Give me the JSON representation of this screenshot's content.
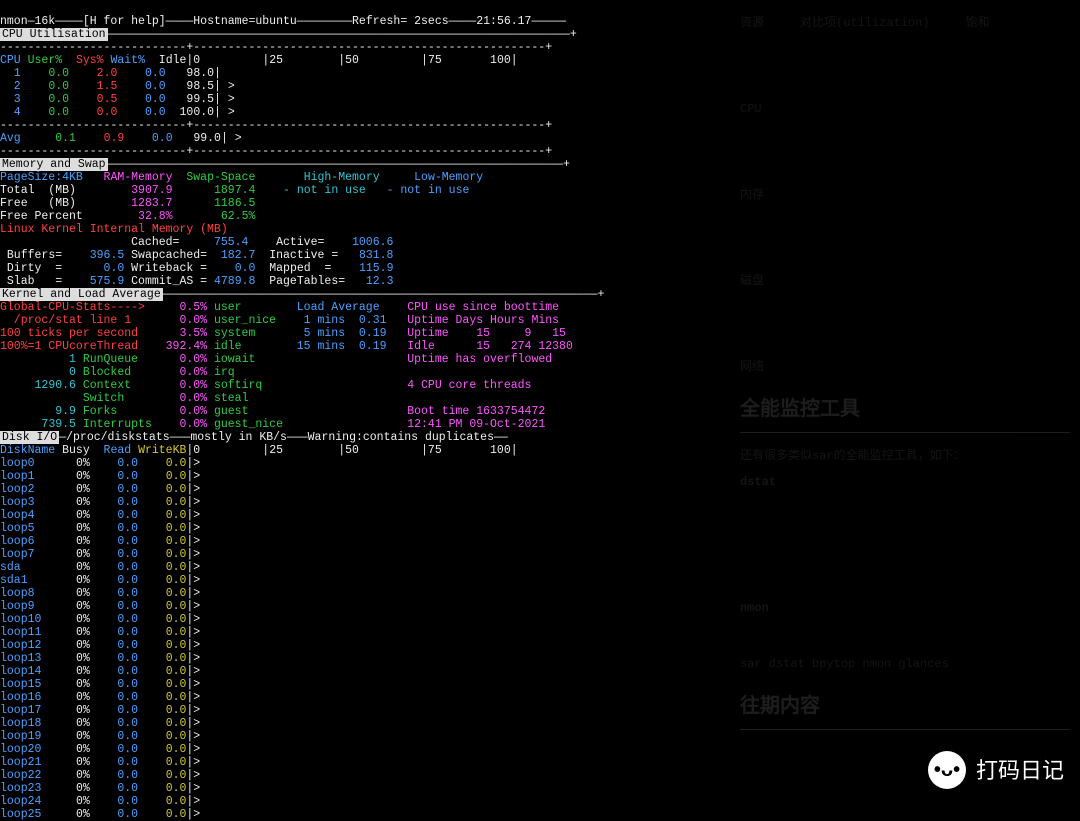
{
  "header": {
    "prog": "nmon—16k",
    "help": "[H for help]",
    "hostname": "Hostname=ubuntu",
    "refresh": "Refresh= 2secs",
    "time": "21:56.17"
  },
  "cpu_section_label": "CPU Utilisation",
  "cpu_header": "CPU User%  Sys% Wait%  Idle|0         |25        |50         |75       100|",
  "cpu_rows": [
    {
      "n": "  1",
      "u": "  0.0",
      "s": "  2.0",
      "w": "  0.0",
      "i": " 98.0",
      "bar": "|  "
    },
    {
      "n": "  2",
      "u": "  0.0",
      "s": "  1.5",
      "w": "  0.0",
      "i": " 98.5",
      "bar": "| >"
    },
    {
      "n": "  3",
      "u": "  0.0",
      "s": "  0.5",
      "w": "  0.0",
      "i": " 99.5",
      "bar": "| >"
    },
    {
      "n": "  4",
      "u": "  0.0",
      "s": "  0.0",
      "w": "  0.0",
      "i": "100.0",
      "bar": "| >"
    }
  ],
  "cpu_avg": {
    "n": "Avg",
    "u": "  0.1",
    "s": "  0.9",
    "w": "  0.0",
    "i": " 99.0",
    "bar": "| >"
  },
  "mem": {
    "label": "Memory and Swap",
    "header": {
      "pagesize": "PageSize:4KB",
      "ram": "RAM-Memory",
      "swap": "Swap-Space",
      "high": "High-Memory",
      "low": "Low-Memory"
    },
    "total": {
      "lbl": "Total  (MB)",
      "ram": "3907.9",
      "swap": "1897.4",
      "high": "- not in use",
      "low": "- not in use"
    },
    "free": {
      "lbl": "Free   (MB)",
      "ram": "1283.7",
      "swap": "1186.5"
    },
    "freepct": {
      "lbl": "Free Percent",
      "ram": "32.8%",
      "swap": "62.5%"
    },
    "kernel_lbl": "Linux Kernel Internal Memory (MB)",
    "kv": {
      "cached": "755.4",
      "active": "1006.6",
      "buffers": "396.5",
      "swapcached": "182.7",
      "inactive": "831.8",
      "dirty": "0.0",
      "writeback": "0.0",
      "mapped": "115.9",
      "slab": "575.9",
      "commit_as": "4789.8",
      "pagetables": "12.3"
    }
  },
  "kernel": {
    "label": "Kernel and Load Average",
    "rows": [
      {
        "l": "Global-CPU-Stats---->",
        "v": "0.5%",
        "k": "user",
        "la_lbl": "Load Average",
        "cpu_lbl": "CPU use since boottime"
      },
      {
        "l": "  /proc/stat line 1",
        "v": "0.0%",
        "k": "user_nice",
        "la": " 1 mins  0.31",
        "cpu": "Uptime Days Hours Mins"
      },
      {
        "l": "100 ticks per second",
        "v": "3.5%",
        "k": "system",
        "la": " 5 mins  0.19",
        "cpu": "Uptime    15     9   15"
      },
      {
        "l": "100%=1 CPUcoreThread",
        "v": "392.4%",
        "k": "idle",
        "la": "15 mins  0.19",
        "cpu": "Idle      15   274 12380"
      },
      {
        "l": "",
        "n": "1",
        "nl": "RunQueue",
        "v": "0.0%",
        "k": "iowait",
        "cpu": "Uptime has overflowed"
      },
      {
        "l": "",
        "n": "0",
        "nl": "Blocked",
        "v": "0.0%",
        "k": "irq",
        "cpu": ""
      },
      {
        "l": "",
        "n": "1290.6",
        "nl": "Context",
        "v": "0.0%",
        "k": "softirq",
        "cpu": "4 CPU core threads"
      },
      {
        "l": "",
        "n": "",
        "nl": "Switch",
        "v": "0.0%",
        "k": "steal",
        "cpu": ""
      },
      {
        "l": "",
        "n": "9.9",
        "nl": "Forks",
        "v": "0.0%",
        "k": "guest",
        "cpu": "Boot time 1633754472"
      },
      {
        "l": "",
        "n": "739.5",
        "nl": "Interrupts",
        "v": "0.0%",
        "k": "guest_nice",
        "cpu": "12:41 PM 09-Oct-2021"
      }
    ]
  },
  "disk": {
    "label": "Disk I/O",
    "title": "—/proc/diskstats———mostly in KB/s———Warning:contains duplicates——",
    "header": "DiskName Busy  Read WriteKB|0         |25        |50         |75       100|",
    "rows": [
      {
        "name": "loop0",
        "busy": "0%",
        "read": "0.0",
        "write": "0.0"
      },
      {
        "name": "loop1",
        "busy": "0%",
        "read": "0.0",
        "write": "0.0"
      },
      {
        "name": "loop2",
        "busy": "0%",
        "read": "0.0",
        "write": "0.0"
      },
      {
        "name": "loop3",
        "busy": "0%",
        "read": "0.0",
        "write": "0.0"
      },
      {
        "name": "loop4",
        "busy": "0%",
        "read": "0.0",
        "write": "0.0"
      },
      {
        "name": "loop5",
        "busy": "0%",
        "read": "0.0",
        "write": "0.0"
      },
      {
        "name": "loop6",
        "busy": "0%",
        "read": "0.0",
        "write": "0.0"
      },
      {
        "name": "loop7",
        "busy": "0%",
        "read": "0.0",
        "write": "0.0"
      },
      {
        "name": "sda",
        "busy": "0%",
        "read": "0.0",
        "write": "0.0"
      },
      {
        "name": "sda1",
        "busy": "0%",
        "read": "0.0",
        "write": "0.0"
      },
      {
        "name": "loop8",
        "busy": "0%",
        "read": "0.0",
        "write": "0.0"
      },
      {
        "name": "loop9",
        "busy": "0%",
        "read": "0.0",
        "write": "0.0"
      },
      {
        "name": "loop10",
        "busy": "0%",
        "read": "0.0",
        "write": "0.0"
      },
      {
        "name": "loop11",
        "busy": "0%",
        "read": "0.0",
        "write": "0.0"
      },
      {
        "name": "loop12",
        "busy": "0%",
        "read": "0.0",
        "write": "0.0"
      },
      {
        "name": "loop13",
        "busy": "0%",
        "read": "0.0",
        "write": "0.0"
      },
      {
        "name": "loop14",
        "busy": "0%",
        "read": "0.0",
        "write": "0.0"
      },
      {
        "name": "loop15",
        "busy": "0%",
        "read": "0.0",
        "write": "0.0"
      },
      {
        "name": "loop16",
        "busy": "0%",
        "read": "0.0",
        "write": "0.0"
      },
      {
        "name": "loop17",
        "busy": "0%",
        "read": "0.0",
        "write": "0.0"
      },
      {
        "name": "loop18",
        "busy": "0%",
        "read": "0.0",
        "write": "0.0"
      },
      {
        "name": "loop19",
        "busy": "0%",
        "read": "0.0",
        "write": "0.0"
      },
      {
        "name": "loop20",
        "busy": "0%",
        "read": "0.0",
        "write": "0.0"
      },
      {
        "name": "loop21",
        "busy": "0%",
        "read": "0.0",
        "write": "0.0"
      },
      {
        "name": "loop22",
        "busy": "0%",
        "read": "0.0",
        "write": "0.0"
      },
      {
        "name": "loop23",
        "busy": "0%",
        "read": "0.0",
        "write": "0.0"
      },
      {
        "name": "loop24",
        "busy": "0%",
        "read": "0.0",
        "write": "0.0"
      },
      {
        "name": "loop25",
        "busy": "0%",
        "read": "0.0",
        "write": "0.0"
      }
    ]
  },
  "right": {
    "heading1": "全能监控工具",
    "line1": "还有很多类似sar的全能监控工具，如下：",
    "tool1": "dstat",
    "tool2": "nmon",
    "tool3": "sar dstat bpytop nmon glances",
    "heading2": "往期内容"
  },
  "watermark": "打码日记"
}
